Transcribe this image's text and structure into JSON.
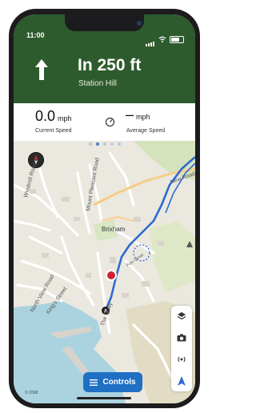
{
  "status_bar": {
    "time": "11:00"
  },
  "navigation": {
    "distance": "In 250 ft",
    "street": "Station Hill"
  },
  "speed_panel": {
    "current_value": "0.0",
    "current_unit": "mph",
    "current_label": "Current Speed",
    "average_value": "–",
    "average_unit": "mph",
    "average_label": "Average Speed"
  },
  "pager": {
    "pages": 5,
    "active_index": 1
  },
  "map": {
    "labels": {
      "windmill_road": "Windmill Road",
      "mount_pleasant_road": "Mount Pleasant Road",
      "new_road": "New Road",
      "brixham": "Brixham",
      "north_view_road": "North View Road",
      "kings_street": "King's Street",
      "the_quay": "The Quay",
      "fore_street": "Fore Street"
    },
    "attribution": "© OSM",
    "route_color": "#2d6ad0"
  },
  "controls_button": {
    "label": "Controls"
  },
  "map_tools": [
    "layers-icon",
    "camera-icon",
    "broadcast-icon",
    "location-arrow-icon"
  ]
}
